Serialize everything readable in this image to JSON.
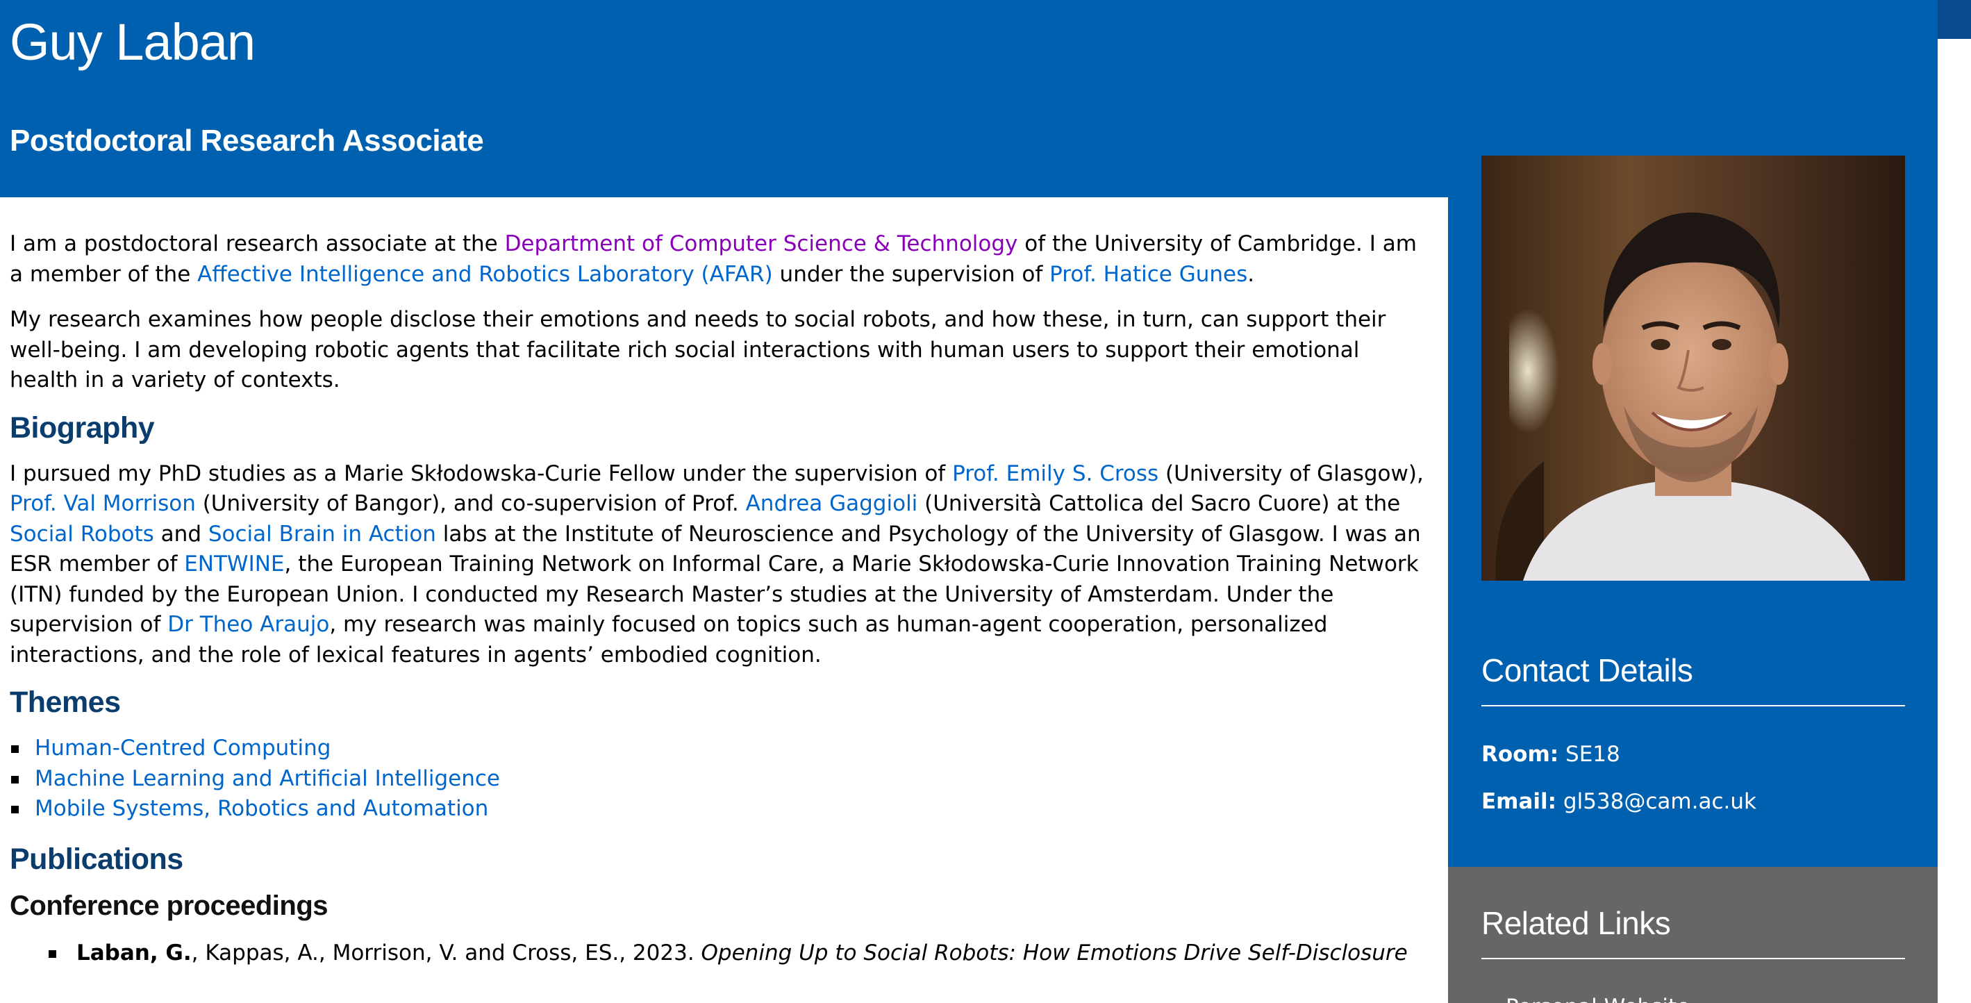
{
  "header": {
    "name": "Guy Laban",
    "title": "Postdoctoral Research Associate"
  },
  "intro": {
    "p1": {
      "t1": "I am a postdoctoral research associate at the ",
      "link_dept": "Department of Computer Science & Technology",
      "t2": " of the University of Cambridge. I am a member of the ",
      "link_afar": "Affective Intelligence and Robotics Laboratory (AFAR)",
      "t3": " under the supervision of ",
      "link_gunes": "Prof. Hatice Gunes",
      "t4": "."
    },
    "p2": "My research examines how people disclose their emotions and needs to social robots, and how these, in turn, can support their well-being.  I am developing robotic agents that facilitate rich social interactions with human users to support their emotional health in a variety of contexts."
  },
  "biography": {
    "heading": "Biography",
    "t1": "I pursued my PhD studies as a Marie Skłodowska-Curie Fellow under the supervision of ",
    "link_cross": "Prof. Emily S. Cross",
    "t2": " (University of Glasgow), ",
    "link_morrison": "Prof. Val Morrison",
    "t3": " (University of Bangor), and co-supervision of Prof. ",
    "link_gaggioli": "Andrea Gaggioli",
    "t4": " (Università Cattolica del Sacro Cuore) at the ",
    "link_social_robots": "Social Robots",
    "t5": " and ",
    "link_sbia": "Social Brain in Action",
    "t6": " labs at the Institute of Neuroscience and Psychology of the University of Glasgow. I was an ESR member of ",
    "link_entwine": "ENTWINE",
    "t7": ", the European Training Network on Informal Care, a Marie Skłodowska-Curie Innovation Training Network (ITN) funded by the European Union. I conducted my Research Master’s studies at the University of Amsterdam. Under the supervision of ",
    "link_araujo": "Dr Theo Araujo",
    "t8": ", my research was mainly focused on topics such as human-agent cooperation, personalized interactions, and the role of lexical features in agents’ embodied cognition."
  },
  "themes": {
    "heading": "Themes",
    "items": [
      "Human-Centred Computing",
      "Machine Learning and Artificial Intelligence",
      "Mobile Systems, Robotics and Automation"
    ]
  },
  "publications": {
    "heading": "Publications",
    "subheading": "Conference proceedings",
    "items": [
      {
        "author_bold": "Laban, G.",
        "rest": ", Kappas, A., Morrison, V. and Cross, ES., 2023. ",
        "title_italic": "Opening Up to Social Robots: How Emotions Drive Self-Disclosure"
      }
    ]
  },
  "sidebar": {
    "contact": {
      "heading": "Contact Details",
      "room_label": "Room:",
      "room_value": " SE18",
      "email_label": "Email:",
      "email_value": " gl538@cam.ac.uk"
    },
    "related": {
      "heading": "Related Links",
      "first_item": "Personal Website"
    }
  },
  "colors": {
    "brand_blue": "#0060b0",
    "link_blue": "#0066cc",
    "visited_purple": "#8a00b8",
    "heading_navy": "#0a3d6e",
    "sidebar_grey": "#666666"
  }
}
